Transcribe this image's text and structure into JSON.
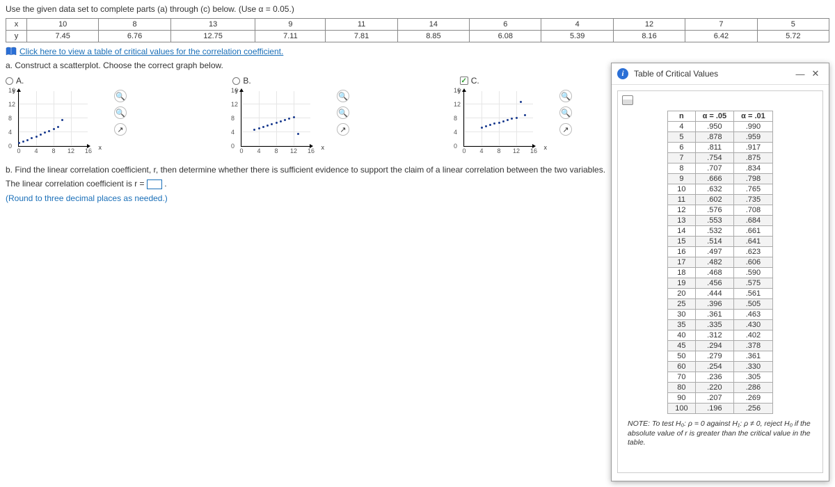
{
  "question": {
    "intro": "Use the given data set to complete parts (a) through (c) below. (Use α = 0.05.)",
    "row_x_label": "x",
    "row_y_label": "y",
    "x": [
      "10",
      "8",
      "13",
      "9",
      "11",
      "14",
      "6",
      "4",
      "12",
      "7",
      "5"
    ],
    "y": [
      "7.45",
      "6.76",
      "12.75",
      "7.11",
      "7.81",
      "8.85",
      "6.08",
      "5.39",
      "8.16",
      "6.42",
      "5.72"
    ],
    "cv_link": "Click here to view a table of critical values for the correlation coefficient.",
    "part_a": "a. Construct a scatterplot. Choose the correct graph below.",
    "opt_a": "A.",
    "opt_b": "B.",
    "opt_c": "C.",
    "checkmark": "✓",
    "part_b": "b. Find the linear correlation coefficient, r, then determine whether there is sufficient evidence to support the claim of a linear correlation between the two variables.",
    "coef_text_pre": "The linear correlation coefficient is r =",
    "coef_text_post": ".",
    "round_note": "(Round to three decimal places as needed.)",
    "axis_y": "y",
    "axis_x": "x",
    "ticks_y": [
      "16",
      "12",
      "8",
      "4",
      "0"
    ],
    "ticks_x": [
      "0",
      "4",
      "8",
      "12",
      "16"
    ]
  },
  "chart_data": [
    {
      "type": "scatter",
      "label": "A",
      "xlim": [
        0,
        16
      ],
      "ylim": [
        0,
        16
      ],
      "points": [
        [
          0,
          1
        ],
        [
          1,
          1.3
        ],
        [
          2,
          1.8
        ],
        [
          3,
          2.3
        ],
        [
          4,
          2.8
        ],
        [
          5,
          3.3
        ],
        [
          6,
          3.9
        ],
        [
          7,
          4.4
        ],
        [
          8,
          5.0
        ],
        [
          9,
          5.6
        ],
        [
          10,
          7.5
        ]
      ]
    },
    {
      "type": "scatter",
      "label": "B",
      "xlim": [
        0,
        16
      ],
      "ylim": [
        0,
        16
      ],
      "points": [
        [
          3,
          4.8
        ],
        [
          4,
          5.2
        ],
        [
          5,
          5.6
        ],
        [
          6,
          6.0
        ],
        [
          7,
          6.4
        ],
        [
          8,
          6.8
        ],
        [
          9,
          7.2
        ],
        [
          10,
          7.6
        ],
        [
          11,
          8.0
        ],
        [
          12,
          8.4
        ],
        [
          13,
          3.5
        ]
      ]
    },
    {
      "type": "scatter",
      "label": "C",
      "xlim": [
        0,
        16
      ],
      "ylim": [
        0,
        16
      ],
      "points": [
        [
          4,
          5.39
        ],
        [
          5,
          5.72
        ],
        [
          6,
          6.08
        ],
        [
          7,
          6.42
        ],
        [
          8,
          6.76
        ],
        [
          9,
          7.11
        ],
        [
          10,
          7.45
        ],
        [
          11,
          7.81
        ],
        [
          12,
          8.16
        ],
        [
          13,
          12.75
        ],
        [
          14,
          8.85
        ]
      ]
    }
  ],
  "popup": {
    "title": "Table of Critical Values",
    "hdr_n": "n",
    "hdr_a05": "α = .05",
    "hdr_a01": "α = .01",
    "rows": [
      {
        "n": "4",
        "a05": ".950",
        "a01": ".990"
      },
      {
        "n": "5",
        "a05": ".878",
        "a01": ".959"
      },
      {
        "n": "6",
        "a05": ".811",
        "a01": ".917"
      },
      {
        "n": "7",
        "a05": ".754",
        "a01": ".875"
      },
      {
        "n": "8",
        "a05": ".707",
        "a01": ".834"
      },
      {
        "n": "9",
        "a05": ".666",
        "a01": ".798"
      },
      {
        "n": "10",
        "a05": ".632",
        "a01": ".765"
      },
      {
        "n": "11",
        "a05": ".602",
        "a01": ".735"
      },
      {
        "n": "12",
        "a05": ".576",
        "a01": ".708"
      },
      {
        "n": "13",
        "a05": ".553",
        "a01": ".684"
      },
      {
        "n": "14",
        "a05": ".532",
        "a01": ".661"
      },
      {
        "n": "15",
        "a05": ".514",
        "a01": ".641"
      },
      {
        "n": "16",
        "a05": ".497",
        "a01": ".623"
      },
      {
        "n": "17",
        "a05": ".482",
        "a01": ".606"
      },
      {
        "n": "18",
        "a05": ".468",
        "a01": ".590"
      },
      {
        "n": "19",
        "a05": ".456",
        "a01": ".575"
      },
      {
        "n": "20",
        "a05": ".444",
        "a01": ".561"
      },
      {
        "n": "25",
        "a05": ".396",
        "a01": ".505"
      },
      {
        "n": "30",
        "a05": ".361",
        "a01": ".463"
      },
      {
        "n": "35",
        "a05": ".335",
        "a01": ".430"
      },
      {
        "n": "40",
        "a05": ".312",
        "a01": ".402"
      },
      {
        "n": "45",
        "a05": ".294",
        "a01": ".378"
      },
      {
        "n": "50",
        "a05": ".279",
        "a01": ".361"
      },
      {
        "n": "60",
        "a05": ".254",
        "a01": ".330"
      },
      {
        "n": "70",
        "a05": ".236",
        "a01": ".305"
      },
      {
        "n": "80",
        "a05": ".220",
        "a01": ".286"
      },
      {
        "n": "90",
        "a05": ".207",
        "a01": ".269"
      },
      {
        "n": "100",
        "a05": ".196",
        "a01": ".256"
      }
    ],
    "note": "NOTE: To test H₀: ρ = 0 against H₁: ρ ≠ 0, reject H₀ if the absolute value of r is greater than the critical value in the table."
  },
  "icons": {
    "zoom_in": "🔍",
    "zoom_out": "🔍",
    "open": "↗",
    "minimize": "—",
    "close": "✕"
  }
}
